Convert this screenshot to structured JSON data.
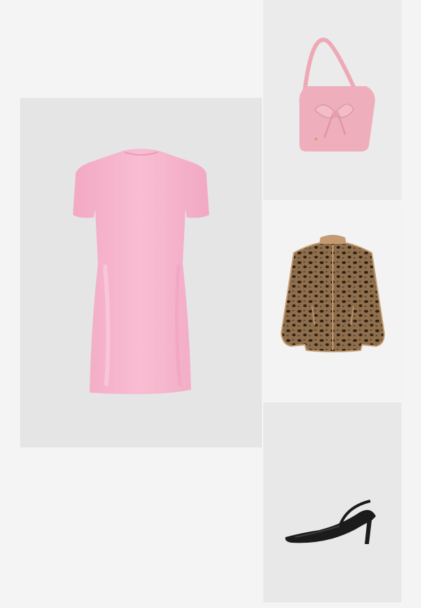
{
  "outfit": {
    "items": [
      {
        "id": "dress",
        "name": "mini-dress",
        "color": "#f7b9cf"
      },
      {
        "id": "bag",
        "name": "shoulder-bag",
        "color": "#efaebb"
      },
      {
        "id": "jacket",
        "name": "leopard-jacket",
        "color": "#8a6a48"
      },
      {
        "id": "shoes",
        "name": "slingback-heels",
        "color": "#1b1b1b"
      }
    ]
  },
  "colors": {
    "page_background": "#f4f4f4",
    "panel_background": "#e7e7e7"
  }
}
